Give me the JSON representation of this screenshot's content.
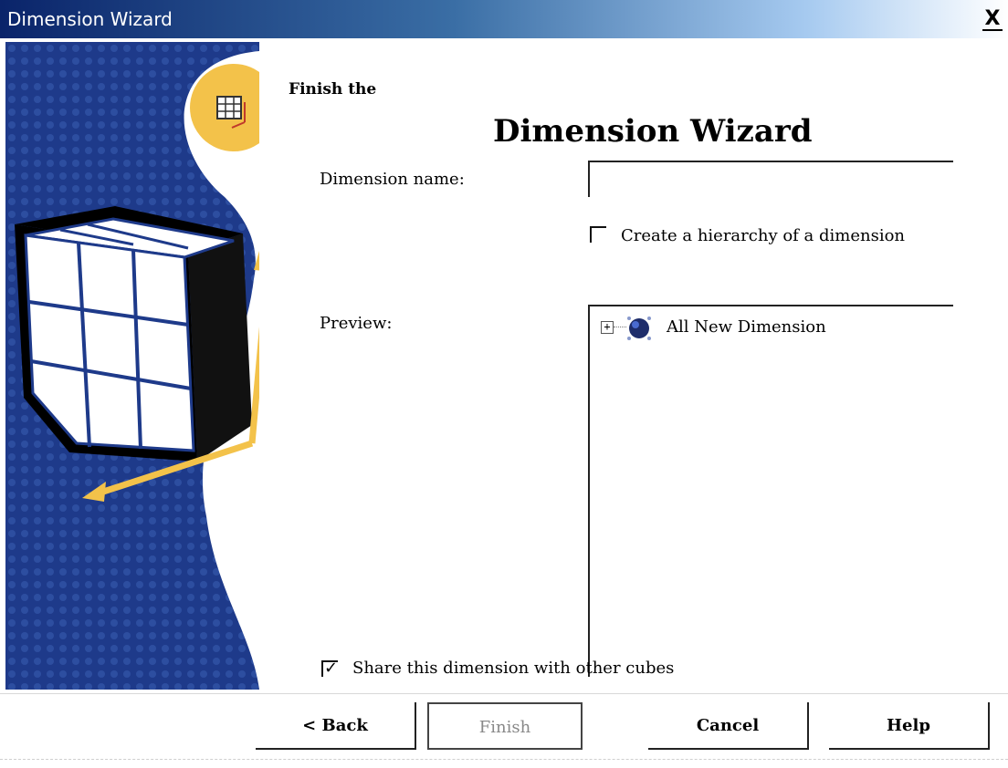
{
  "window": {
    "title": "Dimension Wizard",
    "close_label": "X"
  },
  "header": {
    "line1": "Finish the",
    "line2": "Dimension Wizard"
  },
  "fields": {
    "dimension_name_label": "Dimension name:",
    "dimension_name_value": "",
    "hierarchy_checkbox_label": "Create a hierarchy of a dimension",
    "hierarchy_checked": false,
    "preview_label": "Preview:",
    "share_checkbox_label": "Share this dimension with other cubes",
    "share_checked": true
  },
  "preview_tree": {
    "expander": "+",
    "root_label": "All New Dimension"
  },
  "buttons": {
    "back": "< Back",
    "finish": "Finish",
    "cancel": "Cancel",
    "help": "Help"
  },
  "colors": {
    "title_bar": "#0a246a",
    "art_blue": "#1e3a8a",
    "art_yellow": "#f3c24a"
  }
}
